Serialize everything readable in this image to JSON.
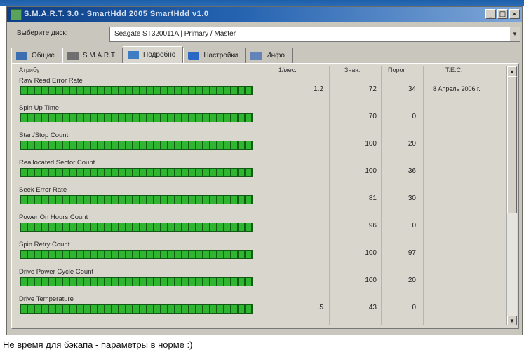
{
  "window": {
    "title": "S.M.A.R.T. 3.0 - SmartHdd 2005 SmartHdd v1.0",
    "buttons": {
      "minimize": "_",
      "maximize": "□",
      "close": "×"
    }
  },
  "disk": {
    "label": "Выберите диск:",
    "selected": "Seagate ST320011A  |  Primary / Master"
  },
  "tabs": [
    {
      "label": "Общие",
      "icon": "drive-icon"
    },
    {
      "label": "S.M.A.R.T",
      "icon": "smart-icon"
    },
    {
      "label": "Подробно",
      "icon": "details-icon",
      "active": true
    },
    {
      "label": "Настройки",
      "icon": "settings-icon"
    },
    {
      "label": "Инфо",
      "icon": "info-icon"
    }
  ],
  "table": {
    "headers": {
      "attr": "Атрибут",
      "per_month": "1/мес.",
      "value": "Знач.",
      "threshold": "Порог",
      "tec": "T.E.C."
    },
    "rows": [
      {
        "name": "Raw Read Error Rate",
        "per_month": "1.2",
        "value": "72",
        "threshold": "34",
        "tec": "8 Апрель 2006 г."
      },
      {
        "name": "Spin Up Time",
        "per_month": "",
        "value": "70",
        "threshold": "0",
        "tec": ""
      },
      {
        "name": "Start/Stop Count",
        "per_month": "",
        "value": "100",
        "threshold": "20",
        "tec": ""
      },
      {
        "name": "Reallocated Sector Count",
        "per_month": "",
        "value": "100",
        "threshold": "36",
        "tec": ""
      },
      {
        "name": "Seek Error Rate",
        "per_month": "",
        "value": "81",
        "threshold": "30",
        "tec": ""
      },
      {
        "name": "Power On Hours Count",
        "per_month": "",
        "value": "96",
        "threshold": "0",
        "tec": ""
      },
      {
        "name": "Spin Retry Count",
        "per_month": "",
        "value": "100",
        "threshold": "97",
        "tec": ""
      },
      {
        "name": "Drive Power Cycle Count",
        "per_month": "",
        "value": "100",
        "threshold": "20",
        "tec": ""
      },
      {
        "name": "Drive Temperature",
        "per_month": ".5",
        "value": "43",
        "threshold": "0",
        "tec": ""
      }
    ]
  },
  "caption": "Не время для бэкапа - параметры в норме :)",
  "colors": {
    "bar_green": "#2fb52f",
    "bar_dark": "#0f5f12",
    "title_blue": "#0d3f86"
  }
}
